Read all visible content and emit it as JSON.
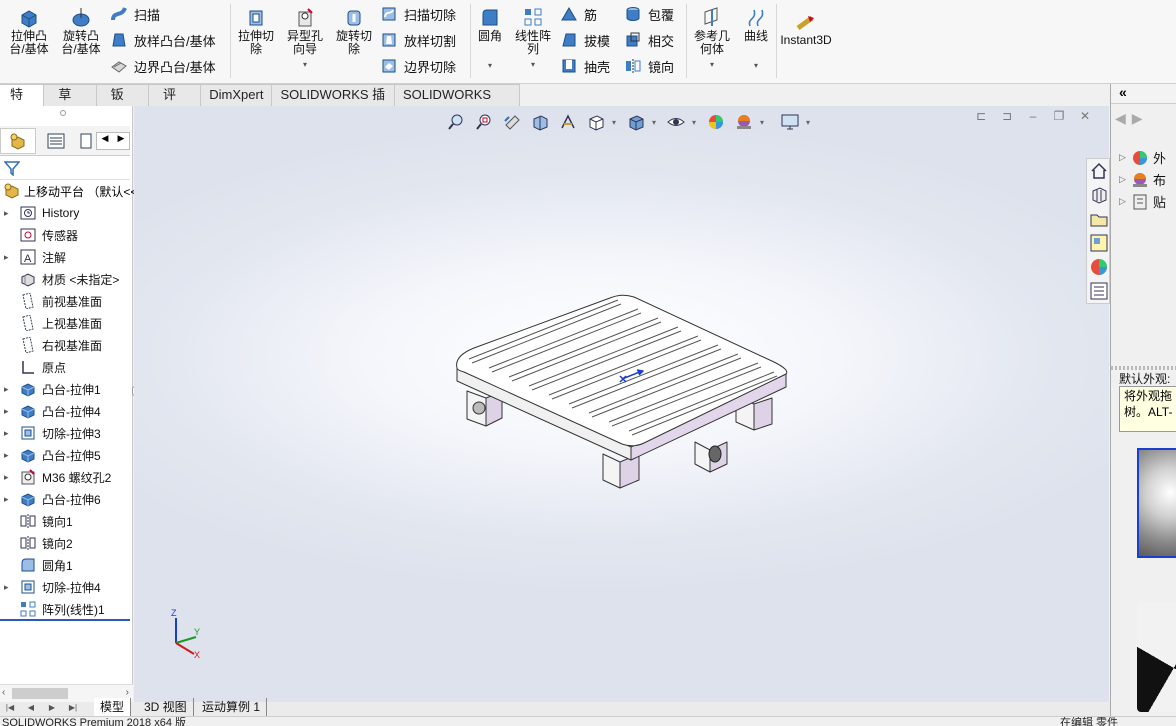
{
  "ribbon": {
    "extrude_boss": "拉伸凸\n台/基体",
    "revolve_boss": "旋转凸\n台/基体",
    "sweep": "扫描",
    "loft_boss": "放样凸台/基体",
    "boundary_boss": "边界凸台/基体",
    "extrude_cut": "拉伸切\n除",
    "hole_wizard": "异型孔\n向导",
    "revolve_cut": "旋转切\n除",
    "swept_cut": "扫描切除",
    "lofted_cut": "放样切割",
    "boundary_cut": "边界切除",
    "fillet": "圆角",
    "linear_pattern": "线性阵\n列",
    "rib": "筋",
    "draft": "拔模",
    "shell": "抽壳",
    "wrap": "包覆",
    "intersect": "相交",
    "mirror": "镜向",
    "ref_geometry": "参考几\n何体",
    "curves": "曲线",
    "instant3d": "Instant3D"
  },
  "tabs": [
    "特征",
    "草图",
    "钣金",
    "评估",
    "DimXpert",
    "SOLIDWORKS 插件",
    "SOLIDWORKS MBD"
  ],
  "tree": {
    "root": "上移动平台 （默认<<",
    "items": [
      {
        "label": "History",
        "expand": true
      },
      {
        "label": "传感器",
        "expand": false
      },
      {
        "label": "注解",
        "expand": true
      },
      {
        "label": "材质 <未指定>",
        "expand": false
      },
      {
        "label": "前视基准面",
        "expand": false
      },
      {
        "label": "上视基准面",
        "expand": false
      },
      {
        "label": "右视基准面",
        "expand": false
      },
      {
        "label": "原点",
        "expand": false
      },
      {
        "label": "凸台-拉伸1",
        "expand": true
      },
      {
        "label": "凸台-拉伸4",
        "expand": true
      },
      {
        "label": "切除-拉伸3",
        "expand": true
      },
      {
        "label": "凸台-拉伸5",
        "expand": true
      },
      {
        "label": "M36 螺纹孔2",
        "expand": true
      },
      {
        "label": "凸台-拉伸6",
        "expand": true
      },
      {
        "label": "镜向1",
        "expand": false
      },
      {
        "label": "镜向2",
        "expand": false
      },
      {
        "label": "圆角1",
        "expand": false
      },
      {
        "label": "切除-拉伸4",
        "expand": true
      },
      {
        "label": "阵列(线性)1",
        "expand": false
      }
    ]
  },
  "taskpane": {
    "header": "«",
    "items": [
      "外",
      "布",
      "贴"
    ],
    "label": "默认外观:",
    "tip_line1": "将外观拖",
    "tip_line2": "树。ALT-"
  },
  "triad": {
    "x": "X",
    "y": "Y",
    "z": "Z"
  },
  "bottom_tabs": [
    "模型",
    "3D 视图",
    "运动算例 1"
  ],
  "status": {
    "left": "SOLIDWORKS Premium 2018 x64 版",
    "right": "在编辑 零件"
  },
  "colors": {
    "accent": "#2c59b5",
    "model_face": "#ffffff",
    "model_side": "#e2d6ea",
    "tree_icon": "#2f6fb5"
  }
}
